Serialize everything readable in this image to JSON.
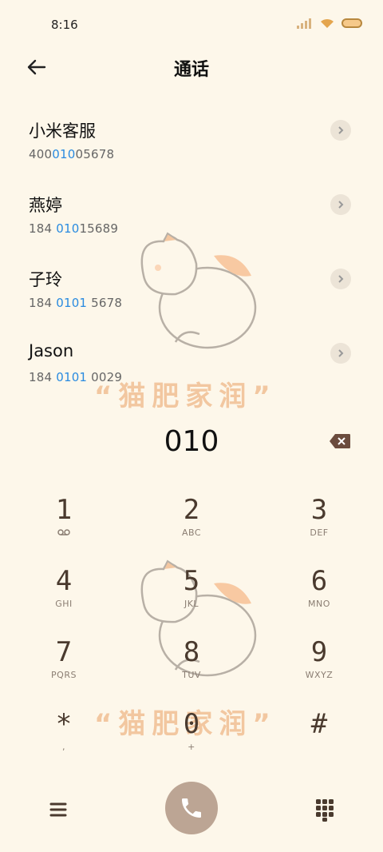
{
  "status": {
    "time": "8:16"
  },
  "header": {
    "title": "通话"
  },
  "contacts": [
    {
      "name": "小米客服",
      "pre": "400",
      "hl": "010",
      "post": "05678"
    },
    {
      "name": "燕婷",
      "pre": "184 ",
      "hl": "010",
      "post": "15689"
    },
    {
      "name": "子玲",
      "pre": "184 ",
      "hl": "0101",
      "post": " 5678"
    },
    {
      "name": "Jason",
      "pre": "184 ",
      "hl": "0101",
      "post": " 0029"
    }
  ],
  "entry": {
    "number": "010"
  },
  "watermark": {
    "text": "“猫肥家润”"
  },
  "keys": [
    {
      "digit": "1",
      "letters": ""
    },
    {
      "digit": "2",
      "letters": "ABC"
    },
    {
      "digit": "3",
      "letters": "DEF"
    },
    {
      "digit": "4",
      "letters": "GHI"
    },
    {
      "digit": "5",
      "letters": "JKL"
    },
    {
      "digit": "6",
      "letters": "MNO"
    },
    {
      "digit": "7",
      "letters": "PQRS"
    },
    {
      "digit": "8",
      "letters": "TUV"
    },
    {
      "digit": "9",
      "letters": "WXYZ"
    },
    {
      "digit": "*",
      "letters": ","
    },
    {
      "digit": "0",
      "letters": "+"
    },
    {
      "digit": "#",
      "letters": ""
    }
  ],
  "icons": {
    "back": "arrow-left-icon",
    "arrow": "chevron-right-icon",
    "backspace": "backspace-icon",
    "voicemail": "voicemail-icon",
    "menu": "menu-icon",
    "call": "phone-icon",
    "dialpad": "dialpad-icon"
  },
  "colors": {
    "background": "#fdf7ea",
    "highlight": "#2a8be0",
    "call_button": "#bca594",
    "watermark": "#f2c7a0"
  }
}
